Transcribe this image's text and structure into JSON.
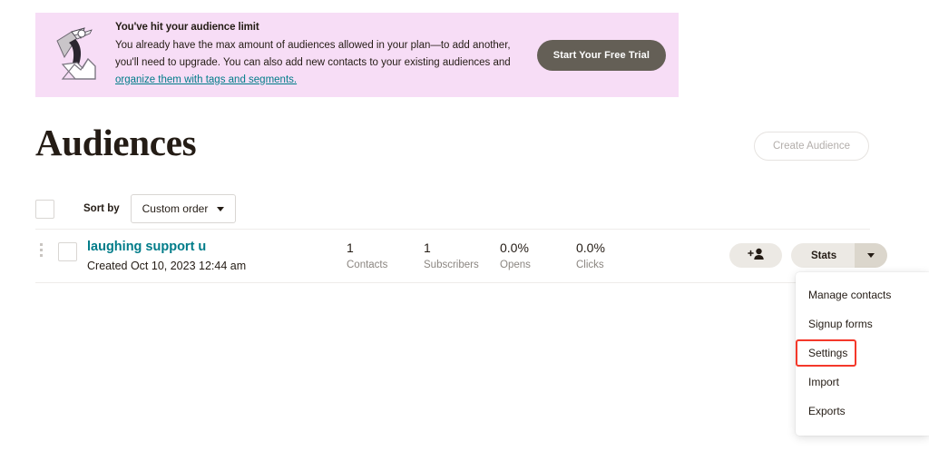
{
  "banner": {
    "title": "You've hit your audience limit",
    "text_part1": "You already have the max amount of audiences allowed in your plan—to add another, you'll need to upgrade. You can also add new contacts to your existing audiences and ",
    "link_text": "organize them with tags and segments.",
    "cta_label": "Start Your Free Trial",
    "background_color": "#f7ddf6",
    "cta_color": "#645f56",
    "illustration": "superhero-mountain-illustration"
  },
  "header": {
    "title": "Audiences",
    "create_button_label": "Create Audience"
  },
  "sortbar": {
    "select_all_checkbox": "unchecked",
    "sort_label": "Sort by",
    "sort_value": "Custom order",
    "chevron_icon": "chevron-down-icon"
  },
  "audience_row": {
    "drag_handle_icon": "drag-dots-icon",
    "row_checkbox": "unchecked",
    "name": "laughing support u",
    "created": "Created Oct 10, 2023 12:44 am",
    "name_color": "#007c89",
    "stats": [
      {
        "value": "1",
        "label": "Contacts"
      },
      {
        "value": "1",
        "label": "Subscribers"
      },
      {
        "value": "0.0%",
        "label": "Opens"
      },
      {
        "value": "0.0%",
        "label": "Clicks"
      }
    ],
    "add_contact_icon": "add-person-icon",
    "stats_button_label": "Stats",
    "stats_caret_icon": "chevron-down-icon"
  },
  "dropdown_menu": {
    "items": [
      {
        "label": "Manage contacts",
        "highlighted": false
      },
      {
        "label": "Signup forms",
        "highlighted": false
      },
      {
        "label": "Settings",
        "highlighted": true
      },
      {
        "label": "Import",
        "highlighted": false
      },
      {
        "label": "Exports",
        "highlighted": false
      }
    ],
    "highlight_color": "#f4382a"
  }
}
